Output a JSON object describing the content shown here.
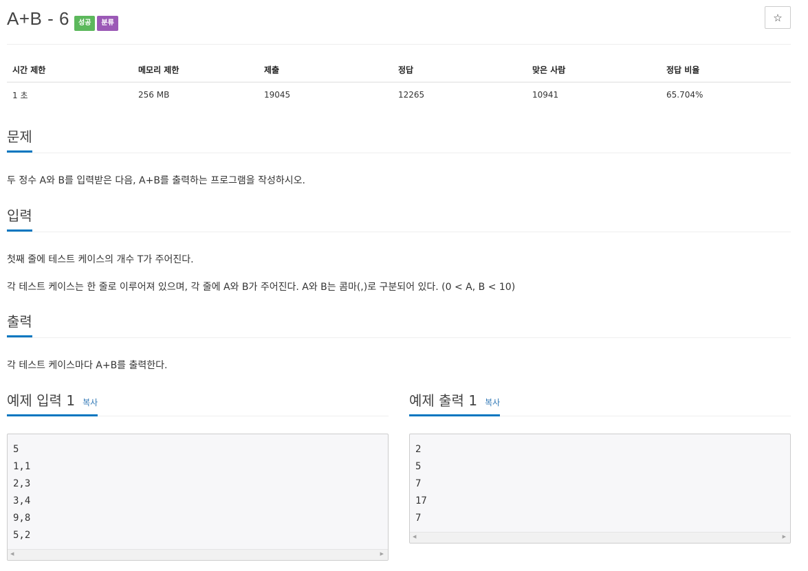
{
  "problem": {
    "title": "A+B - 6",
    "labels": {
      "success": "성공",
      "category": "분류"
    },
    "star_icon": "☆"
  },
  "info_table": {
    "headers": [
      "시간 제한",
      "메모리 제한",
      "제출",
      "정답",
      "맞은 사람",
      "정답 비율"
    ],
    "values": [
      "1 초",
      "256 MB",
      "19045",
      "12265",
      "10941",
      "65.704%"
    ]
  },
  "description": {
    "heading": "문제",
    "text": "두 정수 A와 B를 입력받은 다음, A+B를 출력하는 프로그램을 작성하시오."
  },
  "input": {
    "heading": "입력",
    "lines": [
      "첫째 줄에 테스트 케이스의 개수 T가 주어진다.",
      "각 테스트 케이스는 한 줄로 이루어져 있으며, 각 줄에 A와 B가 주어진다. A와 B는 콤마(,)로 구분되어 있다. (0 < A, B < 10)"
    ]
  },
  "output": {
    "heading": "출력",
    "text": "각 테스트 케이스마다 A+B를 출력한다."
  },
  "sample_input": {
    "heading": "예제 입력 1",
    "copy_label": "복사",
    "lines": [
      "5",
      "1,1",
      "2,3",
      "3,4",
      "9,8",
      "5,2"
    ]
  },
  "sample_output": {
    "heading": "예제 출력 1",
    "copy_label": "복사",
    "lines": [
      "2",
      "5",
      "7",
      "17",
      "7"
    ]
  },
  "scrollbar": {
    "left_arrow": "◀",
    "right_arrow": "▶"
  },
  "colors": {
    "accent": "#0076c0",
    "label_success": "#5cb85c",
    "label_category": "#9b59b6",
    "link": "#337ab7"
  }
}
